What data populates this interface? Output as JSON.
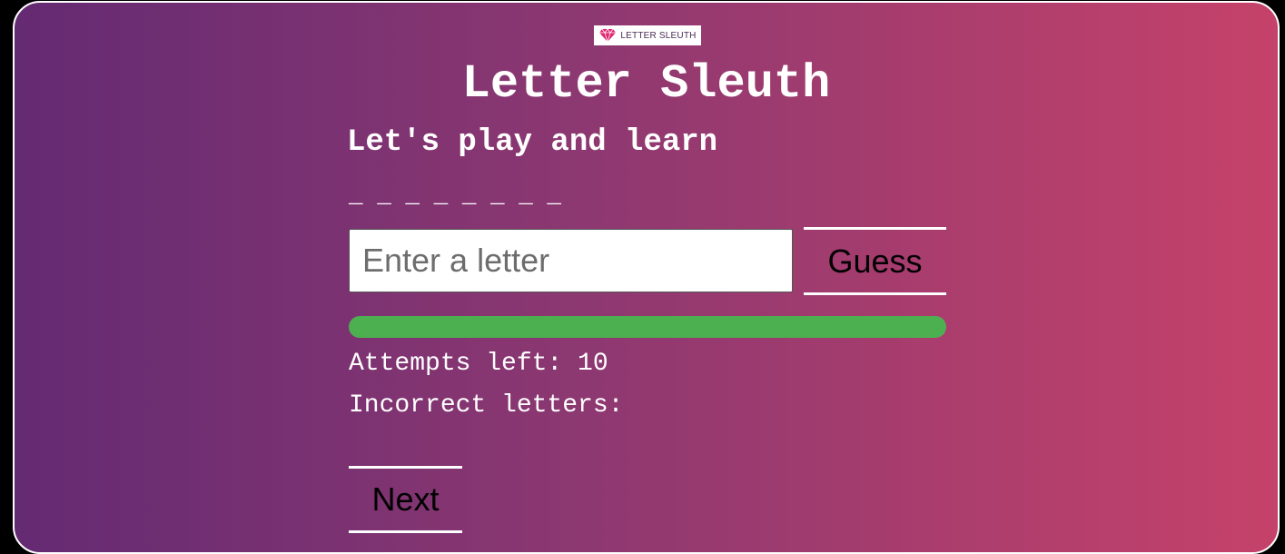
{
  "app": {
    "logo_text": "LETTER SLEUTH",
    "logo_icon": "gem-icon",
    "title": "Letter Sleuth",
    "subtitle": "Let's play and learn"
  },
  "game": {
    "word_mask": "_ _ _ _ _ _ _ _",
    "input_value": "",
    "input_placeholder": "Enter a letter",
    "guess_label": "Guess",
    "progress_fraction": 1.0,
    "attempts_label": "Attempts left: 10",
    "incorrect_label": "Incorrect letters:",
    "next_label": "Next"
  },
  "colors": {
    "gradient_start": "#642a72",
    "gradient_end": "#c5426a",
    "progress": "#4caf50",
    "gem": "#e0246e"
  }
}
